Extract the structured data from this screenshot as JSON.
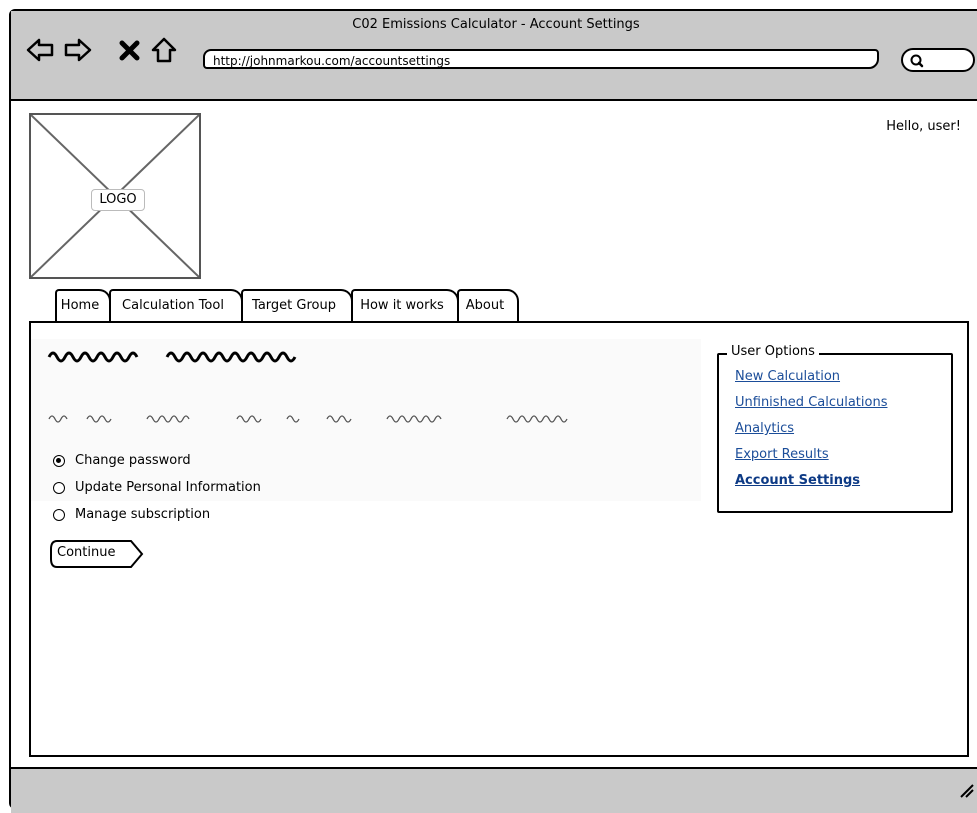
{
  "window": {
    "title": "C02 Emissions Calculator - Account Settings"
  },
  "toolbar": {
    "url": "http://johnmarkou.com/accountsettings",
    "icons": [
      "back-arrow-icon",
      "forward-arrow-icon",
      "stop-icon",
      "home-icon",
      "search-icon"
    ]
  },
  "header": {
    "logo_label": "LOGO",
    "greeting": "Hello, user!"
  },
  "tabs": [
    {
      "label": "Home"
    },
    {
      "label": "Calculation Tool"
    },
    {
      "label": "Target Group"
    },
    {
      "label": "How it works"
    },
    {
      "label": "About"
    }
  ],
  "form": {
    "options": [
      {
        "label": "Change password",
        "selected": true
      },
      {
        "label": "Update Personal Information",
        "selected": false
      },
      {
        "label": "Manage subscription",
        "selected": false
      }
    ],
    "continue_label": "Continue"
  },
  "user_options": {
    "legend": "User Options",
    "links": [
      {
        "label": "New Calculation",
        "active": false
      },
      {
        "label": "Unfinished Calculations",
        "active": false
      },
      {
        "label": "Analytics",
        "active": false
      },
      {
        "label": "Export Results",
        "active": false
      },
      {
        "label": "Account Settings",
        "active": true
      }
    ]
  },
  "colors": {
    "chrome": "#c9c9c9",
    "link": "#1b4d99"
  }
}
